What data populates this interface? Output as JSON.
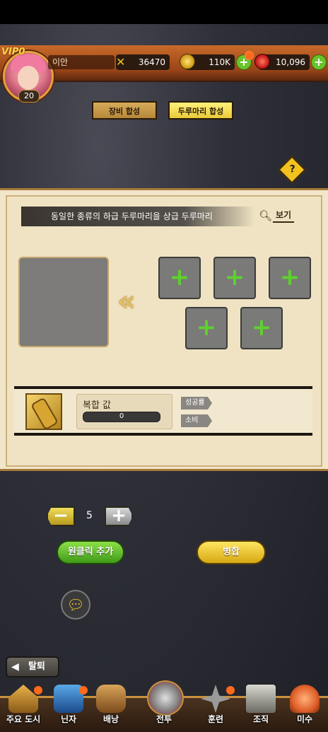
{
  "player": {
    "vip_label": "VIP0",
    "name": "이안",
    "level": "20"
  },
  "resources": {
    "power": "36470",
    "coins": "110K",
    "gems": "10,096"
  },
  "tabs": [
    {
      "label": "장비 합성"
    },
    {
      "label": "두루마리 합성"
    }
  ],
  "help": {
    "symbol": "?"
  },
  "panel": {
    "description": "동일한 종류의 하급 두루마리을 상급 두루마리",
    "view_label": "보기",
    "arrows": "«",
    "slot_plus": "+"
  },
  "result": {
    "compound_label": "복합 값",
    "compound_value": "0",
    "success_label": "성공률",
    "cost_label": "소비"
  },
  "quantity": {
    "value": "5",
    "minus": "−",
    "plus": "+"
  },
  "buttons": {
    "one_click_add": "원클릭 추가",
    "merge": "병합",
    "exit": "탈퇴"
  },
  "nav": [
    {
      "label": "주요 도시",
      "icon": "castle-icon"
    },
    {
      "label": "닌자",
      "icon": "headband-icon"
    },
    {
      "label": "배낭",
      "icon": "backpack-icon"
    },
    {
      "label": "전투",
      "icon": "crossed-kunai-icon"
    },
    {
      "label": "훈련",
      "icon": "shuriken-icon"
    },
    {
      "label": "조직",
      "icon": "building-icon"
    },
    {
      "label": "미수",
      "icon": "fox-icon"
    }
  ],
  "colors": {
    "accent_green": "#5ed12e",
    "accent_yellow": "#f2c21f",
    "panel_bg": "#f1e6c9"
  }
}
